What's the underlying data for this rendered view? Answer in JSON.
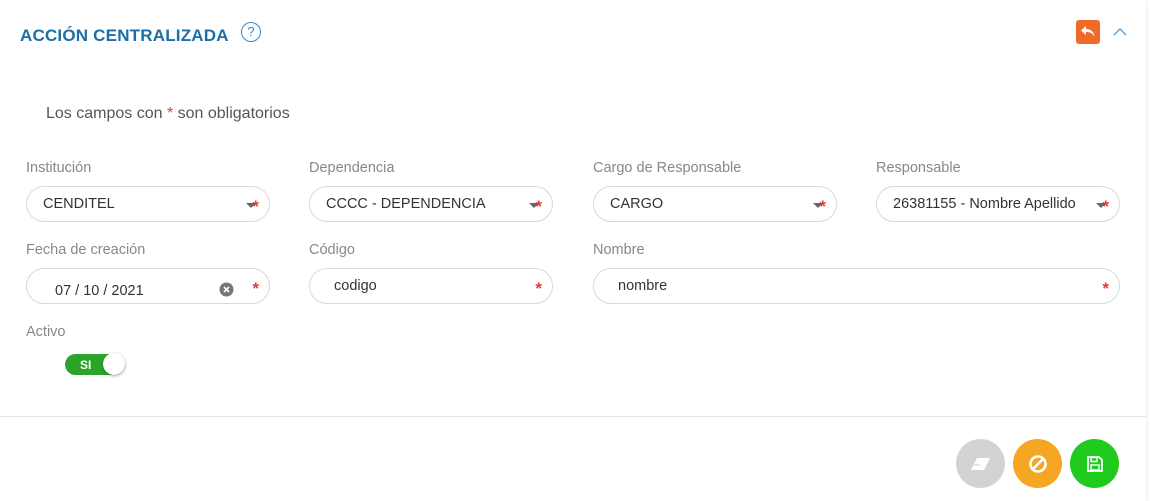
{
  "header": {
    "title": "ACCIÓN CENTRALIZADA",
    "help_glyph": "?"
  },
  "required_note": {
    "prefix": "Los campos con ",
    "asterisk": "*",
    "suffix": " son obligatorios"
  },
  "fields": {
    "institucion": {
      "label": "Institución",
      "value": "CENDITEL"
    },
    "dependencia": {
      "label": "Dependencia",
      "value": "CCCC - DEPENDENCIA"
    },
    "cargo": {
      "label": "Cargo de Responsable",
      "value": "CARGO"
    },
    "responsable": {
      "label": "Responsable",
      "value": "26381155 - Nombre Apellido"
    },
    "fecha": {
      "label": "Fecha de creación",
      "value": "07 / 10 / 2021"
    },
    "codigo": {
      "label": "Código",
      "value": "codigo"
    },
    "nombre": {
      "label": "Nombre",
      "value": "nombre"
    },
    "activo": {
      "label": "Activo",
      "toggle_text": "SI",
      "checked": true
    }
  },
  "required_star": "*",
  "icons": {
    "help": "question-circle-icon",
    "undo": "undo-icon",
    "collapse": "chevron-up-icon",
    "clear": "eraser-icon",
    "cancel": "ban-icon",
    "save": "floppy-disk-icon"
  },
  "colors": {
    "title": "#1a6fa8",
    "undo": "#f06a2a",
    "required": "#e53935",
    "toggle_on": "#2aa52a",
    "clear_button": "#d3d3d3",
    "cancel_button": "#f5a623",
    "save_button": "#1ecb1e"
  }
}
